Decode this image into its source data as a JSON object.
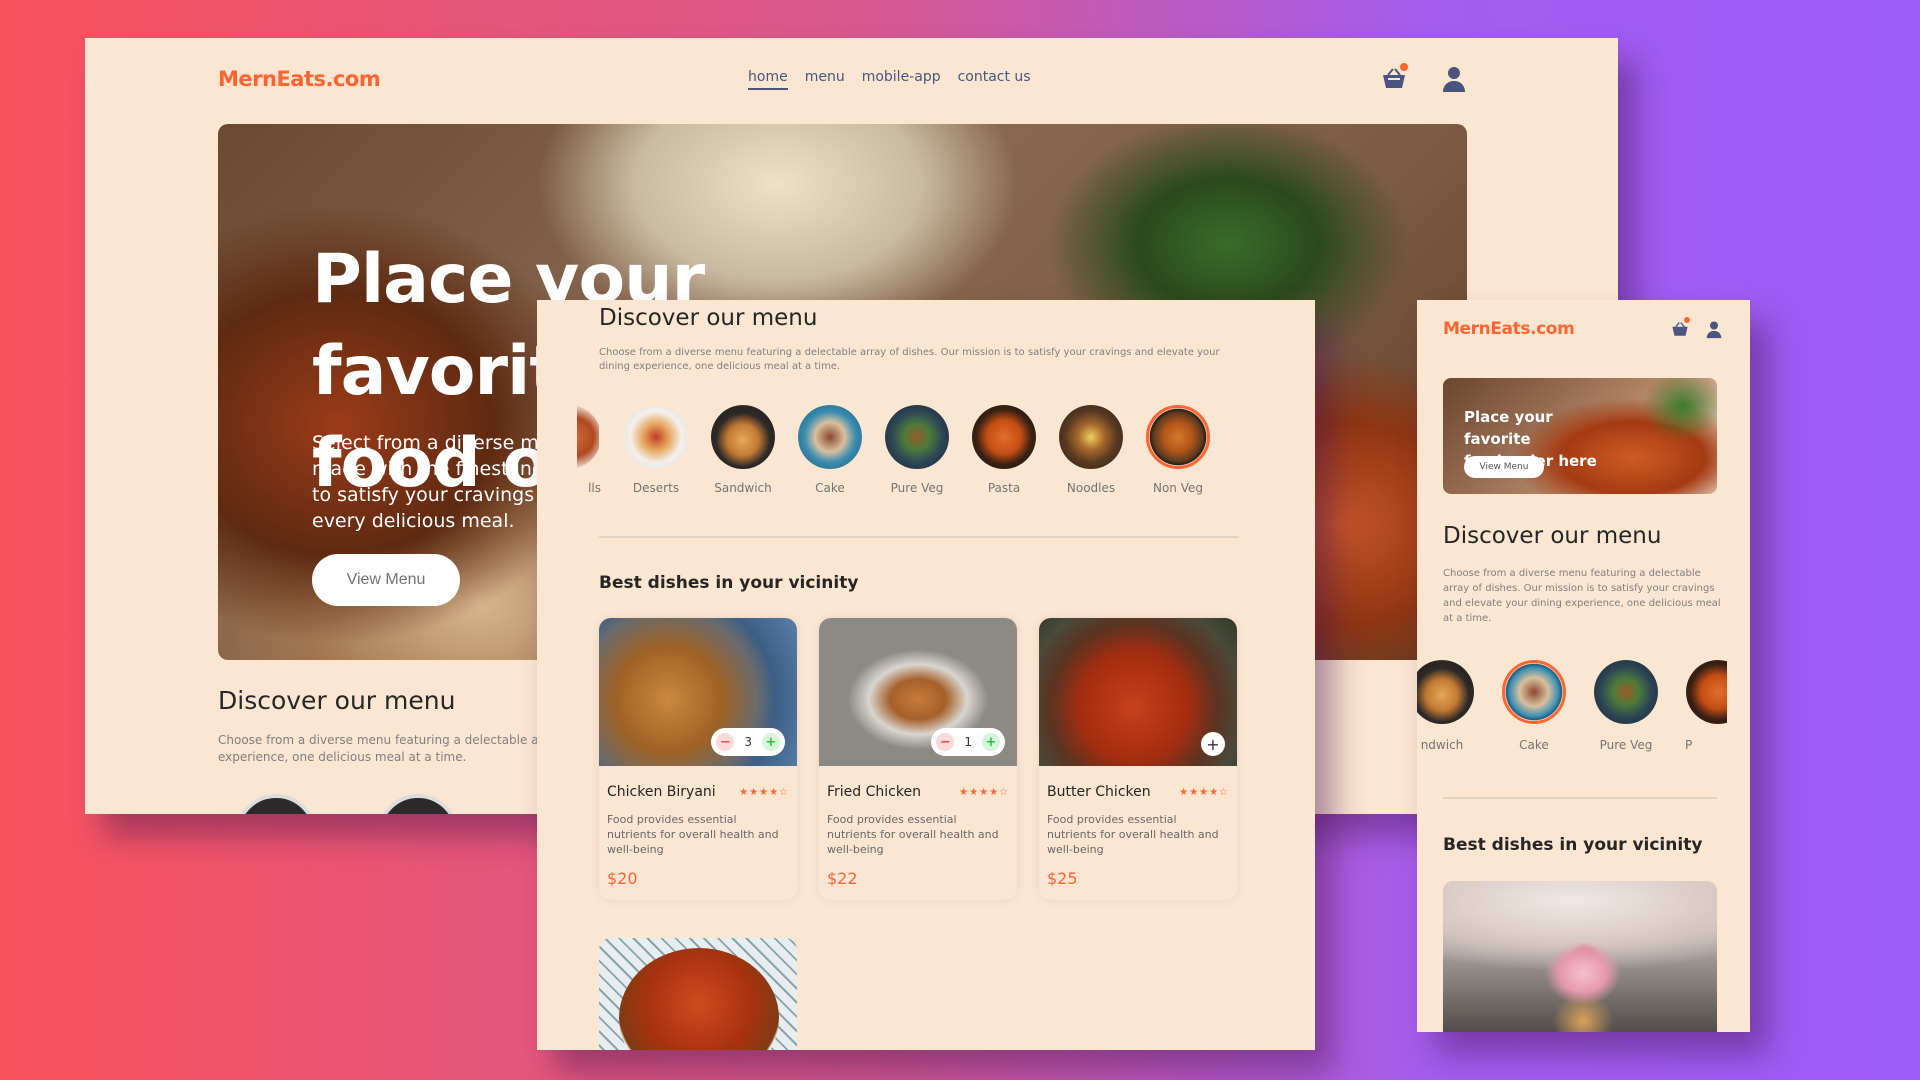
{
  "brand": "MernEats.com",
  "nav": {
    "links": [
      "home",
      "menu",
      "mobile-app",
      "contact us"
    ],
    "active": "home"
  },
  "colors": {
    "accent": "#ff6433",
    "panel_bg": "#fbe6d2",
    "background_left": "#f9535e",
    "background_right": "#9c5cf6"
  },
  "icons": {
    "cart": "basket-icon",
    "profile": "user-icon"
  },
  "hero": {
    "title_line1": "Place your favorite",
    "title_line2": "food or",
    "subtitle_line1": "Select from a diverse me",
    "subtitle_line2": "made with the finest ingr",
    "subtitle_line3": "to satisfy your cravings a",
    "subtitle_line4": "every delicious meal.",
    "button": "View Menu"
  },
  "desktop_discover": {
    "heading": "Discover our menu",
    "text_line1": "Choose from a diverse menu featuring a delectable arr",
    "text_line2": "experience, one delicious meal at a time."
  },
  "tablet": {
    "heading": "Discover our menu",
    "text": "Choose from a diverse menu featuring a delectable array of dishes. Our mission is to satisfy your cravings and elevate your dining experience, one delicious meal at a time.",
    "menu": [
      {
        "label": "lls"
      },
      {
        "label": "Deserts"
      },
      {
        "label": "Sandwich"
      },
      {
        "label": "Cake"
      },
      {
        "label": "Pure Veg"
      },
      {
        "label": "Pasta"
      },
      {
        "label": "Noodles"
      },
      {
        "label": "Non Veg"
      }
    ],
    "best_heading": "Best dishes in your vicinity",
    "dishes": [
      {
        "name": "Chicken Biryani",
        "desc": "Food provides essential nutrients for overall health and well-being",
        "price": "$20",
        "count": "3",
        "rating": 4
      },
      {
        "name": "Fried Chicken",
        "desc": "Food provides essential nutrients for overall health and well-being",
        "price": "$22",
        "count": "1",
        "rating": 4
      },
      {
        "name": "Butter Chicken",
        "desc": "Food provides essential nutrients for overall health and well-being",
        "price": "$25",
        "count": "",
        "rating": 4
      }
    ]
  },
  "mobile": {
    "hero_title_line1": "Place your favorite",
    "hero_title_line2": "food order here",
    "hero_button": "View Menu",
    "heading": "Discover our menu",
    "text": "Choose from a diverse menu featuring a delectable array of dishes. Our mission is to satisfy your cravings and elevate your dining experience, one delicious meal at a time.",
    "menu": [
      {
        "label": "ndwich"
      },
      {
        "label": "Cake"
      },
      {
        "label": "Pure Veg"
      },
      {
        "label": "P"
      }
    ],
    "best_heading": "Best dishes in your vicinity"
  }
}
